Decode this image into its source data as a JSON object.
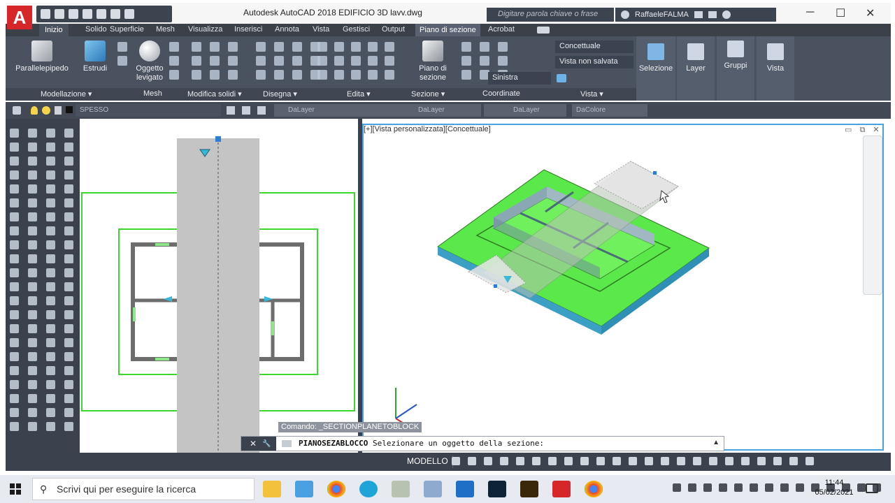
{
  "window": {
    "logo_letter": "A",
    "title": "Autodesk AutoCAD 2018     EDIFICIO 3D lavv.dwg",
    "search_placeholder": "Digitare parola chiave o frase",
    "user": "RaffaeleFALMA",
    "controls": {
      "minimize": "─",
      "maximize": "☐",
      "close": "✕"
    }
  },
  "ribbon": {
    "tabs": [
      "Inizio",
      "Solido",
      "Superficie",
      "Mesh",
      "Visualizza",
      "Inserisci",
      "Annota",
      "Vista",
      "Gestisci",
      "Output",
      "Piano di sezione",
      "Acrobat"
    ],
    "active_tab": "Inizio",
    "big_buttons": {
      "parallelepipedo": "Parallelepipedo",
      "estrudi": "Estrudi",
      "oggetto_levigato": "Oggetto levigato",
      "piano_sezione": "Piano di sezione",
      "selezione": "Selezione",
      "layer": "Layer",
      "gruppi": "Gruppi",
      "vista": "Vista"
    },
    "visual_style": "Concettuale",
    "view_state": "Vista non salvata",
    "viewport_side": "Sinistra",
    "groups": [
      "Modellazione ▾",
      "Mesh",
      "Modifica solidi ▾",
      "Disegna ▾",
      "Edita ▾",
      "Sezione ▾",
      "Coordinate",
      "Vista ▾"
    ]
  },
  "layerbar": {
    "current_layer": "SPESSO",
    "color": "DaLayer",
    "linetype": "DaLayer",
    "lineweight": "DaLayer",
    "plotstyle": "DaColore"
  },
  "viewport": {
    "label": "[+][Vista personalizzata][Concettuale]",
    "controls": "▭ ⧉ ✕"
  },
  "command": {
    "history": "Comando: _SECTIONPLANETOBLOCK",
    "name": "PIANOSEZABLOCCO",
    "prompt": "Selezionare un oggetto della sezione:",
    "close_icon": "✕",
    "settings_icon": "🔧",
    "expand_icon": "▲"
  },
  "statusbar": {
    "model_tab": "MODELLO"
  },
  "taskbar": {
    "search_placeholder": "Scrivi qui per eseguire la ricerca",
    "time": "11:44",
    "date": "05/02/2021"
  },
  "colors": {
    "ribbon": "#4a5260",
    "accent_green": "#5be84a",
    "viewport_border": "#4aa3df",
    "autocad_red": "#d7262a"
  }
}
